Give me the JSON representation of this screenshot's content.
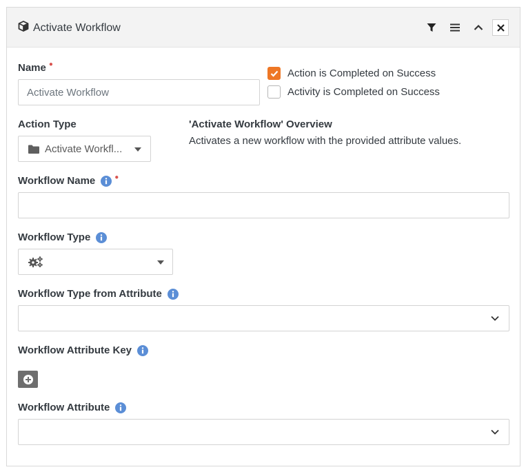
{
  "header": {
    "title": "Activate Workflow",
    "filter_icon": "filter-icon",
    "menu_icon": "hamburger-icon",
    "collapse_icon": "chevron-up-icon",
    "close_label": "✕"
  },
  "form": {
    "name_label": "Name",
    "name_value": "Activate Workflow",
    "action_completed_label": "Action is Completed on Success",
    "action_completed_checked": true,
    "activity_completed_label": "Activity is Completed on Success",
    "activity_completed_checked": false,
    "action_type_label": "Action Type",
    "action_type_value": "Activate Workfl...",
    "overview_title": "'Activate Workflow' Overview",
    "overview_desc": "Activates a new workflow with the provided attribute values.",
    "workflow_name_label": "Workflow Name",
    "workflow_name_value": "",
    "workflow_type_label": "Workflow Type",
    "workflow_type_from_attr_label": "Workflow Type from Attribute",
    "workflow_attr_key_label": "Workflow Attribute Key",
    "workflow_attr_label": "Workflow Attribute"
  },
  "colors": {
    "accent": "#ee7725",
    "required": "#d9534f",
    "info": "#5b8ed6"
  }
}
